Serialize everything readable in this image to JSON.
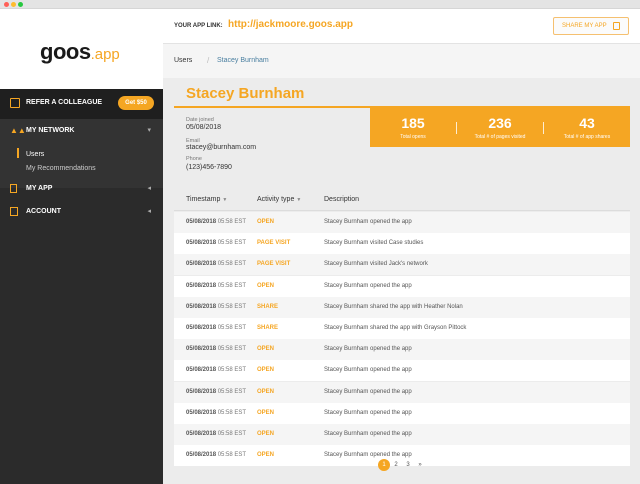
{
  "brand": {
    "logo_main": "goos",
    "logo_suffix": ".app"
  },
  "sidebar": {
    "refer_label": "REFER A COLLEAGUE",
    "refer_button": "Get $50",
    "network_label": "MY NETWORK",
    "network_items": [
      "Users",
      "My Recommendations"
    ],
    "myapp_label": "MY APP",
    "account_label": "ACCOUNT"
  },
  "header": {
    "app_link_label": "YOUR APP LINK:",
    "app_link_url": "http://jackmoore.goos.app",
    "share_label": "SHARE MY APP"
  },
  "breadcrumb": {
    "root": "Users",
    "sep": "/",
    "current": "Stacey Burnham"
  },
  "profile": {
    "name": "Stacey Burnham",
    "date_joined_label": "Date joined",
    "date_joined": "05/08/2018",
    "email_label": "Email",
    "email": "stacey@burnham.com",
    "phone_label": "Phone",
    "phone": "(123)456-7890"
  },
  "stats": [
    {
      "value": "185",
      "caption": "Total opens"
    },
    {
      "value": "236",
      "caption": "Total # of pages visited"
    },
    {
      "value": "43",
      "caption": "Total # of app shares"
    }
  ],
  "table": {
    "headers": {
      "timestamp": "Timestamp",
      "activity": "Activity type",
      "description": "Description"
    },
    "rows": [
      {
        "date": "05/08/2018",
        "time": "05:58 EST",
        "type": "OPEN",
        "desc": "Stacey Burnham opened the app"
      },
      {
        "date": "05/08/2018",
        "time": "05:58 EST",
        "type": "PAGE VISIT",
        "desc": "Stacey Burnham visited  Case studies"
      },
      {
        "date": "05/08/2018",
        "time": "05:58 EST",
        "type": "PAGE VISIT",
        "desc": "Stacey Burnham visited Jack's network"
      },
      {
        "date": "05/08/2018",
        "time": "05:58 EST",
        "type": "OPEN",
        "desc": "Stacey Burnham opened the app"
      },
      {
        "date": "05/08/2018",
        "time": "05:58 EST",
        "type": "SHARE",
        "desc": "Stacey Burnham shared the app with Heather Nolan"
      },
      {
        "date": "05/08/2018",
        "time": "05:58 EST",
        "type": "SHARE",
        "desc": "Stacey Burnham shared the app with Grayson Pittock"
      },
      {
        "date": "05/08/2018",
        "time": "05:58 EST",
        "type": "OPEN",
        "desc": "Stacey Burnham opened the app"
      },
      {
        "date": "05/08/2018",
        "time": "05:58 EST",
        "type": "OPEN",
        "desc": "Stacey Burnham opened the app"
      },
      {
        "date": "05/08/2018",
        "time": "05:58 EST",
        "type": "OPEN",
        "desc": "Stacey Burnham opened the app"
      },
      {
        "date": "05/08/2018",
        "time": "05:58 EST",
        "type": "OPEN",
        "desc": "Stacey Burnham opened the app"
      },
      {
        "date": "05/08/2018",
        "time": "05:58 EST",
        "type": "OPEN",
        "desc": "Stacey Burnham opened the app"
      },
      {
        "date": "05/08/2018",
        "time": "05:58 EST",
        "type": "OPEN",
        "desc": "Stacey Burnham opened the app"
      }
    ]
  },
  "pagination": {
    "pages": [
      "1",
      "2",
      "3",
      "»"
    ],
    "current": "1"
  },
  "colors": {
    "accent": "#f5a623",
    "sidebar": "#2b2b2b"
  }
}
